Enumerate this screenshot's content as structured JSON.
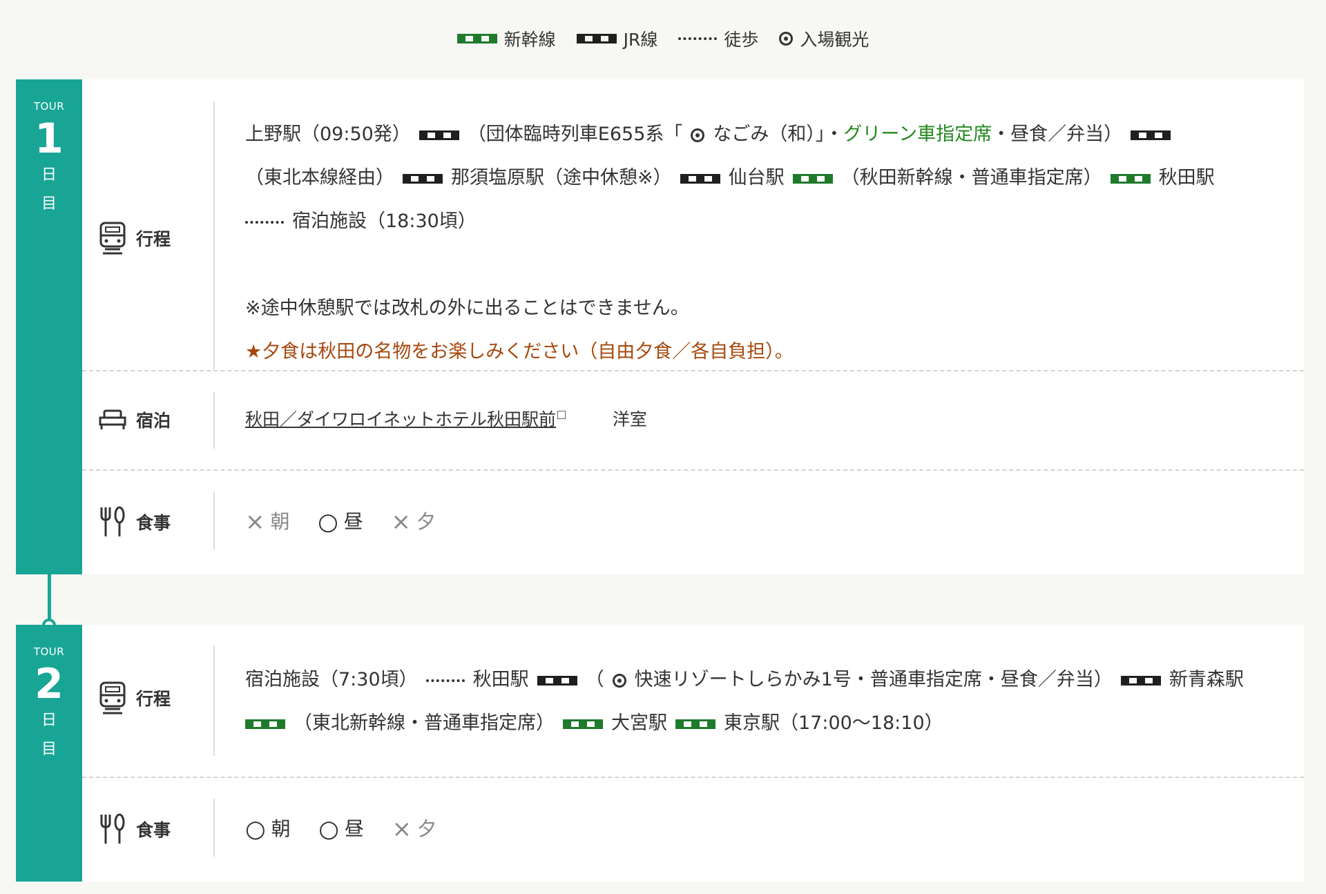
{
  "legend": {
    "shinkansen": "新幹線",
    "jr": "JR線",
    "walk": "徒歩",
    "sightseeing": "入場観光"
  },
  "labels": {
    "tour": "TOUR",
    "day_kanji_1": "日",
    "day_kanji_2": "目",
    "itinerary": "行程",
    "lodging": "宿泊",
    "meals": "食事"
  },
  "day1": {
    "num": "1",
    "itinerary": {
      "ueno": "上野駅（09:50発）",
      "train_open": "（団体臨時列車E655系「",
      "train_name": "なごみ（和）」・",
      "green_seat": "グリーン車指定席",
      "lunch": "・昼食／弁当）",
      "route": "（東北本線経由）",
      "nasu": "那須塩原駅（途中休憩※）",
      "sendai": "仙台駅",
      "akita_shinkansen": "（秋田新幹線・普通車指定席）",
      "akita": "秋田駅",
      "hotel_arrive": "宿泊施設（18:30頃）",
      "note": "※途中休憩駅では改札の外に出ることはできません。",
      "dinner_note": "★夕食は秋田の名物をお楽しみください（自由夕食／各自負担）。"
    },
    "lodging": {
      "hotel": "秋田／ダイワロイネットホテル秋田駅前",
      "room": "洋室"
    },
    "meals": {
      "breakfast": {
        "mark": "×",
        "label": "朝"
      },
      "lunch": {
        "mark": "○",
        "label": "昼"
      },
      "dinner": {
        "mark": "×",
        "label": "夕"
      }
    }
  },
  "day2": {
    "num": "2",
    "itinerary": {
      "depart": "宿泊施設（7:30頃）",
      "akita": "秋田駅",
      "paren_open": "（",
      "rapid": "快速リゾートしらかみ1号・普通車指定席・昼食／弁当）",
      "shin_aomori": "新青森駅",
      "tohoku_shinkansen": "（東北新幹線・普通車指定席）",
      "omiya": "大宮駅",
      "tokyo": "東京駅（17:00～18:10）"
    },
    "meals": {
      "breakfast": {
        "mark": "○",
        "label": "朝"
      },
      "lunch": {
        "mark": "○",
        "label": "昼"
      },
      "dinner": {
        "mark": "×",
        "label": "夕"
      }
    }
  }
}
